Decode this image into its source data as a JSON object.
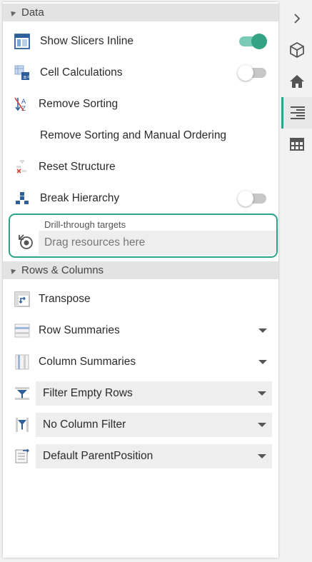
{
  "sections": {
    "data": {
      "title": "Data"
    },
    "rows_columns": {
      "title": "Rows & Columns"
    }
  },
  "data_items": [
    {
      "label": "Show Slicers Inline",
      "icon": "slicer-icon",
      "toggle": true
    },
    {
      "label": "Cell Calculations",
      "icon": "calculator-icon",
      "toggle": false
    },
    {
      "label": "Remove Sorting",
      "icon": "sort-az-icon"
    },
    {
      "label": "Remove Sorting and Manual Ordering"
    },
    {
      "label": "Reset Structure",
      "icon": "reset-structure-icon"
    },
    {
      "label": "Break Hierarchy",
      "icon": "hierarchy-icon",
      "toggle": false
    }
  ],
  "drill_through": {
    "label": "Drill-through targets",
    "placeholder": "Drag resources here",
    "icon": "drill-through-icon"
  },
  "rows_columns_items": [
    {
      "label": "Transpose",
      "icon": "transpose-icon"
    },
    {
      "label": "Row Summaries",
      "icon": "row-summaries-icon"
    },
    {
      "label": "Column Summaries",
      "icon": "column-summaries-icon"
    },
    {
      "label": "Filter Empty Rows",
      "icon": "filter-rows-icon"
    },
    {
      "label": "No Column Filter",
      "icon": "filter-columns-icon"
    },
    {
      "label": "Default ParentPosition",
      "icon": "parent-position-icon"
    }
  ],
  "rail": [
    "chevron-right-icon",
    "cube-icon",
    "home-icon",
    "properties-icon",
    "table-icon"
  ],
  "colors": {
    "accent": "#2aa58a",
    "toggle_on": "#33a384",
    "section_header": "#e3e3e3"
  }
}
